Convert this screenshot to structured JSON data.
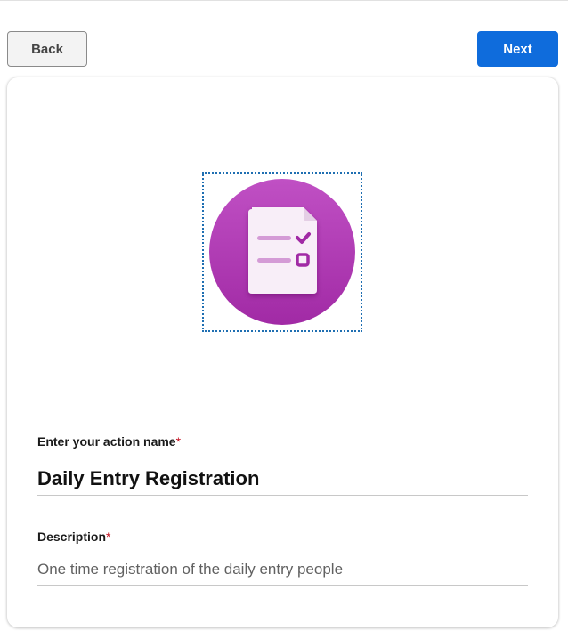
{
  "nav": {
    "back_label": "Back",
    "next_label": "Next"
  },
  "card": {
    "icon": "form-checklist-icon",
    "name_field": {
      "label": "Enter your action name",
      "required_mark": "*",
      "value": "Daily Entry Registration"
    },
    "description_field": {
      "label": "Description",
      "required_mark": "*",
      "value": "One time registration of the daily entry people"
    }
  },
  "colors": {
    "primary": "#0f6cdc",
    "icon_circle": "#b03bb3",
    "required": "#c50f1f"
  }
}
